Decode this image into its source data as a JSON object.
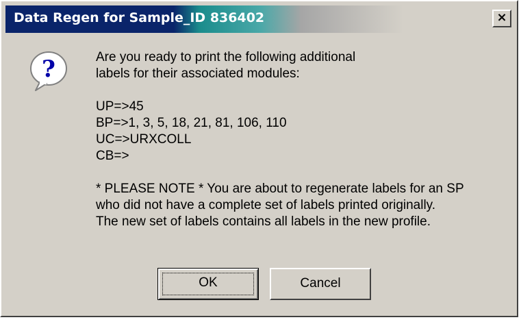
{
  "window": {
    "title": "Data Regen for Sample_ID 836402",
    "close_label": "×"
  },
  "icons": {
    "message_icon": "question-icon"
  },
  "message": {
    "line1": "Are you ready to print the following additional",
    "line2": "labels for their associated modules:",
    "modules": [
      "UP=>45",
      "BP=>1, 3, 5, 18, 21, 81, 106, 110",
      "UC=>URXCOLL",
      "CB=>"
    ],
    "note_lines": [
      "* PLEASE NOTE * You are about to regenerate labels for an SP",
      "who did not have a complete set of labels printed originally.",
      "The new set of labels contains all labels in the new profile."
    ]
  },
  "buttons": {
    "ok_label": "OK",
    "cancel_label": "Cancel"
  },
  "colors": {
    "title_active": "#0a246a",
    "dialog_face": "#d4d0c8"
  }
}
